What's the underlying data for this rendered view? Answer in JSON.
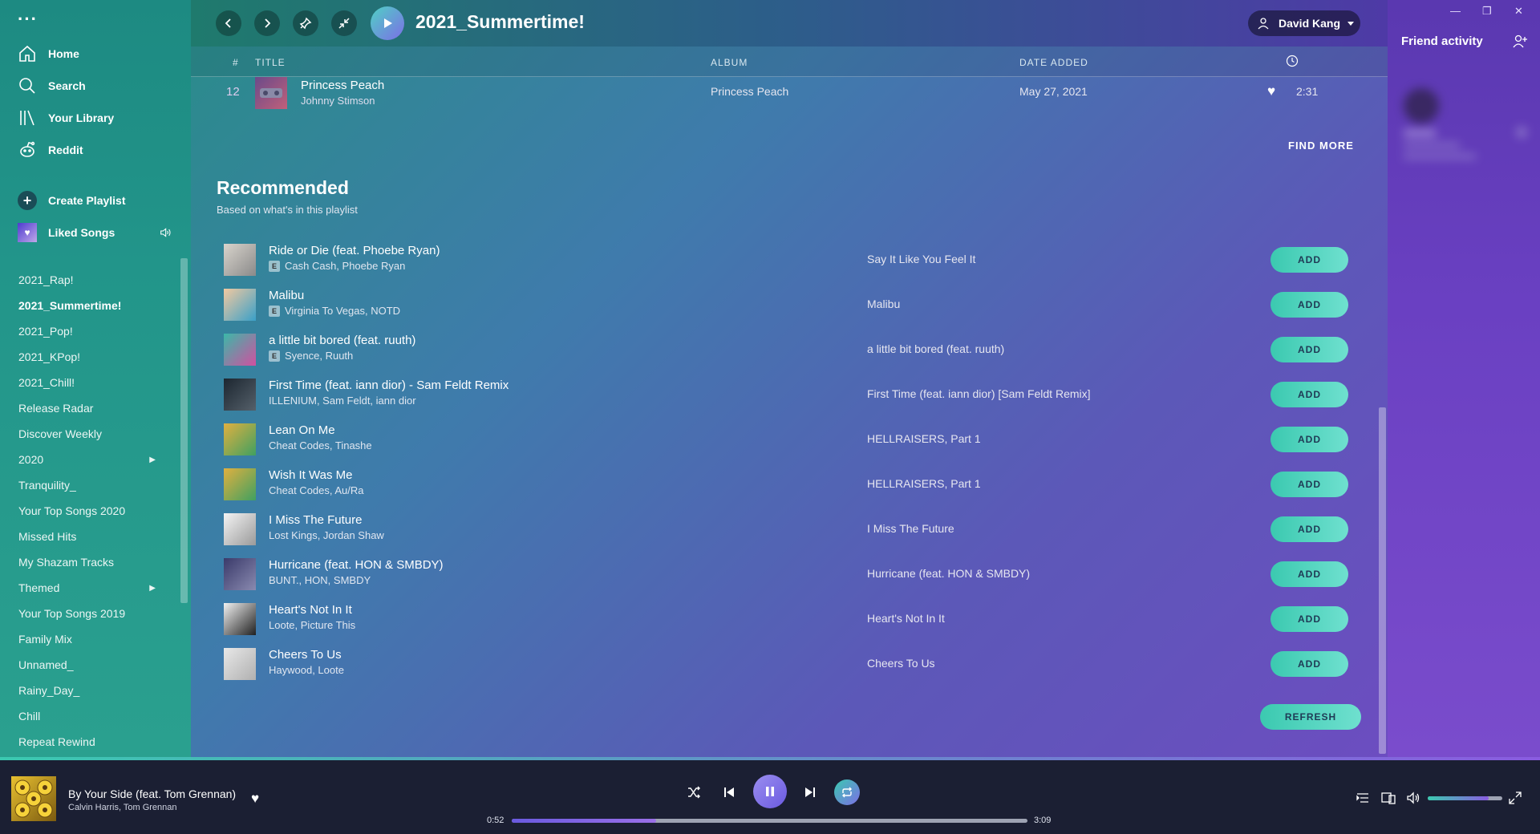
{
  "sidebar": {
    "nav": [
      {
        "label": "Home",
        "icon": "home-icon"
      },
      {
        "label": "Search",
        "icon": "search-icon"
      },
      {
        "label": "Your Library",
        "icon": "library-icon"
      },
      {
        "label": "Reddit",
        "icon": "reddit-icon"
      }
    ],
    "create_playlist": "Create Playlist",
    "liked_songs": "Liked Songs",
    "playlists": [
      {
        "label": "2021_Rap!"
      },
      {
        "label": "2021_Summertime!",
        "active": true
      },
      {
        "label": "2021_Pop!"
      },
      {
        "label": "2021_KPop!"
      },
      {
        "label": "2021_Chill!"
      },
      {
        "label": "Release Radar"
      },
      {
        "label": "Discover Weekly"
      },
      {
        "label": "2020",
        "folder": true
      },
      {
        "label": "Tranquility_"
      },
      {
        "label": "Your Top Songs 2020"
      },
      {
        "label": "Missed Hits"
      },
      {
        "label": "My Shazam Tracks"
      },
      {
        "label": "Themed",
        "folder": true
      },
      {
        "label": "Your Top Songs 2019"
      },
      {
        "label": "Family Mix"
      },
      {
        "label": "Unnamed_"
      },
      {
        "label": "Rainy_Day_"
      },
      {
        "label": "Chill"
      },
      {
        "label": "Repeat Rewind"
      }
    ]
  },
  "header": {
    "playlist_title": "2021_Summertime!",
    "user_name": "David Kang"
  },
  "columns": {
    "num": "#",
    "title": "TITLE",
    "album": "ALBUM",
    "date_added": "DATE ADDED"
  },
  "track": {
    "num": "12",
    "title": "Princess Peach",
    "artist": "Johnny Stimson",
    "album": "Princess Peach",
    "date_added": "May 27, 2021",
    "duration": "2:31"
  },
  "find_more": "FIND MORE",
  "recommended": {
    "title": "Recommended",
    "subtitle": "Based on what's in this playlist",
    "add_label": "ADD",
    "refresh_label": "REFRESH",
    "items": [
      {
        "title": "Ride or Die (feat. Phoebe Ryan)",
        "artists": "Cash Cash, Phoebe Ryan",
        "album": "Say It Like You Feel It",
        "explicit": true,
        "art": [
          "#d9d4cc",
          "#8a8a8a"
        ]
      },
      {
        "title": "Malibu",
        "artists": "Virginia To Vegas, NOTD",
        "album": "Malibu",
        "explicit": true,
        "art": [
          "#f2c9a0",
          "#3aa0c8"
        ]
      },
      {
        "title": "a little bit bored (feat. ruuth)",
        "artists": "Syence, Ruuth",
        "album": "a little bit bored (feat. ruuth)",
        "explicit": true,
        "art": [
          "#3bb8a8",
          "#d050a0"
        ]
      },
      {
        "title": "First Time (feat. iann dior) - Sam Feldt Remix",
        "artists": "ILLENIUM, Sam Feldt, iann dior",
        "album": "First Time (feat. iann dior) [Sam Feldt Remix]",
        "explicit": false,
        "art": [
          "#1c2630",
          "#55606a"
        ]
      },
      {
        "title": "Lean On Me",
        "artists": "Cheat Codes, Tinashe",
        "album": "HELLRAISERS, Part 1",
        "explicit": false,
        "art": [
          "#e0b040",
          "#40a060"
        ]
      },
      {
        "title": "Wish It Was Me",
        "artists": "Cheat Codes, Au/Ra",
        "album": "HELLRAISERS, Part 1",
        "explicit": false,
        "art": [
          "#e0b040",
          "#40a060"
        ]
      },
      {
        "title": "I Miss The Future",
        "artists": "Lost Kings, Jordan Shaw",
        "album": "I Miss The Future",
        "explicit": false,
        "art": [
          "#f4f4f4",
          "#9a9a9a"
        ]
      },
      {
        "title": "Hurricane (feat. HON & SMBDY)",
        "artists": "BUNT., HON, SMBDY",
        "album": "Hurricane (feat. HON & SMBDY)",
        "explicit": false,
        "art": [
          "#3a3a6a",
          "#8a8ab0"
        ]
      },
      {
        "title": "Heart's Not In It",
        "artists": "Loote, Picture This",
        "album": "Heart's Not In It",
        "explicit": false,
        "art": [
          "#f2f2f2",
          "#202020"
        ]
      },
      {
        "title": "Cheers To Us",
        "artists": "Haywood, Loote",
        "album": "Cheers To Us",
        "explicit": false,
        "art": [
          "#e8e8e8",
          "#b0b0b0"
        ]
      }
    ]
  },
  "friend_activity": {
    "title": "Friend activity"
  },
  "now_playing": {
    "title": "By Your Side (feat. Tom Grennan)",
    "artists": "Calvin Harris, Tom Grennan",
    "elapsed": "0:52",
    "duration": "3:09",
    "progress": 0.28,
    "volume": 0.82
  },
  "colors": {
    "accent": "#3bc9b0",
    "purple": "#6a5ae0"
  }
}
